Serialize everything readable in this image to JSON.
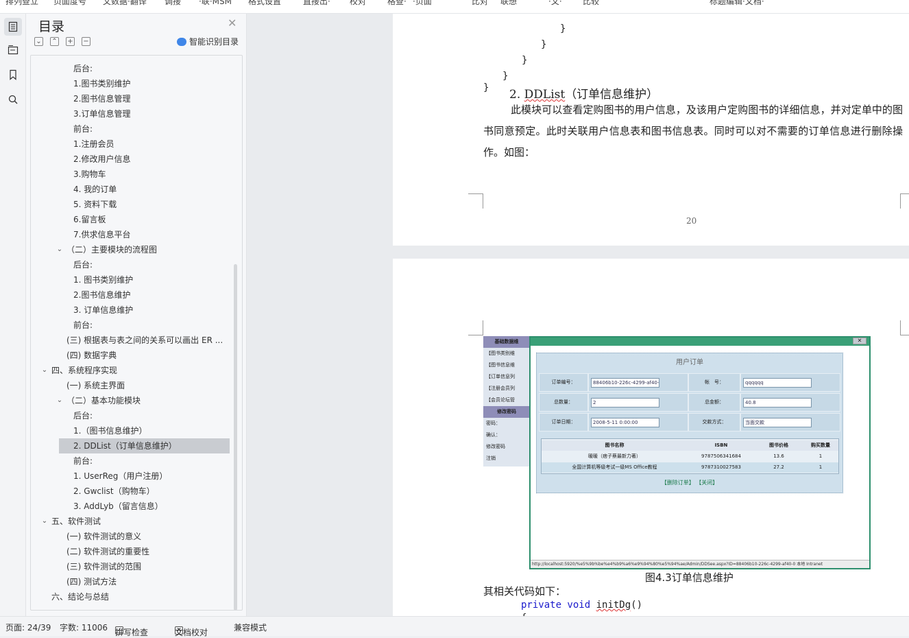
{
  "topbar": {
    "items": [
      "排列查立",
      "页面度号",
      "文数据·翻译",
      "调接",
      "·联·MSM",
      "格式设置",
      "直接出·",
      "校对",
      "格查·",
      "·页面",
      "比对",
      "联想",
      "·文·",
      "比较",
      "标题编辑·文档·"
    ]
  },
  "iconbar": {
    "icons": [
      "toc-icon",
      "outline-icon",
      "bookmark-icon",
      "search-icon"
    ]
  },
  "toc": {
    "title": "目录",
    "smart_label": "智能识别目录",
    "items": [
      {
        "text": "后台:",
        "indent": 3,
        "chev": ""
      },
      {
        "text": "1.图书类别维护",
        "indent": 3,
        "chev": ""
      },
      {
        "text": "2.图书信息管理",
        "indent": 3,
        "chev": ""
      },
      {
        "text": "3.订单信息管理",
        "indent": 3,
        "chev": ""
      },
      {
        "text": "前台:",
        "indent": 3,
        "chev": ""
      },
      {
        "text": "1.注册会员",
        "indent": 3,
        "chev": ""
      },
      {
        "text": "2.修改用户信息",
        "indent": 3,
        "chev": ""
      },
      {
        "text": "3.购物车",
        "indent": 3,
        "chev": ""
      },
      {
        "text": "4. 我的订单",
        "indent": 3,
        "chev": ""
      },
      {
        "text": "5. 资料下载",
        "indent": 3,
        "chev": ""
      },
      {
        "text": "6.留言板",
        "indent": 3,
        "chev": ""
      },
      {
        "text": "7.供求信息平台",
        "indent": 3,
        "chev": ""
      },
      {
        "text": "（二）主要模块的流程图",
        "indent": 2,
        "chev": "v"
      },
      {
        "text": "后台:",
        "indent": 3,
        "chev": ""
      },
      {
        "text": "1. 图书类别维护",
        "indent": 3,
        "chev": ""
      },
      {
        "text": "2.图书信息维护",
        "indent": 3,
        "chev": ""
      },
      {
        "text": "3. 订单信息维护",
        "indent": 3,
        "chev": ""
      },
      {
        "text": "前台:",
        "indent": 3,
        "chev": ""
      },
      {
        "text": "(三) 根据表与表之间的关系可以画出 ER ...",
        "indent": 2,
        "chev": ""
      },
      {
        "text": "(四) 数据字典",
        "indent": 2,
        "chev": ""
      },
      {
        "text": "四、系统程序实现",
        "indent": 1,
        "chev": "v"
      },
      {
        "text": "(一) 系统主界面",
        "indent": 2,
        "chev": ""
      },
      {
        "text": "（二）基本功能模块",
        "indent": 2,
        "chev": "v"
      },
      {
        "text": "后台:",
        "indent": 3,
        "chev": ""
      },
      {
        "text": "1.（图书信息维护）",
        "indent": 3,
        "chev": ""
      },
      {
        "text": "2. DDList（订单信息维护）",
        "indent": 3,
        "chev": "",
        "selected": true
      },
      {
        "text": "前台:",
        "indent": 3,
        "chev": ""
      },
      {
        "text": "1. UserReg（用户注册）",
        "indent": 3,
        "chev": ""
      },
      {
        "text": "2. Gwclist（购物车）",
        "indent": 3,
        "chev": ""
      },
      {
        "text": "3. AddLyb（留言信息）",
        "indent": 3,
        "chev": ""
      },
      {
        "text": "五、软件测试",
        "indent": 1,
        "chev": "v"
      },
      {
        "text": "(一)   软件测试的意义",
        "indent": 2,
        "chev": ""
      },
      {
        "text": "(二) 软件测试的重要性",
        "indent": 2,
        "chev": ""
      },
      {
        "text": "(三) 软件测试的范围",
        "indent": 2,
        "chev": ""
      },
      {
        "text": "(四) 测试方法",
        "indent": 2,
        "chev": ""
      },
      {
        "text": "六、结论与总结",
        "indent": 1,
        "chev": ""
      }
    ]
  },
  "page1": {
    "braces": [
      "}",
      "}",
      "}",
      "}",
      "}"
    ],
    "heading_num": "2.",
    "heading_code": "DDList",
    "heading_text": "（订单信息维护）",
    "paragraph": "此模块可以查看定购图书的用户信息，及该用户定购图书的详细信息，并对定单中的图书同意预定。此时关联用户信息表和图书信息表。同时可以对不需要的订单信息进行删除操作。如图：",
    "page_number": "20"
  },
  "figure": {
    "left_menu": [
      "基础数据维",
      "【图书类别维",
      "【图书信息维",
      "【订单信息列",
      "【注册会员列",
      "【会员论坛管",
      "修改密码",
      "密码：",
      "确认：",
      "修改密码",
      "注销"
    ],
    "window_title": "用户订单",
    "fields": {
      "order_no_label": "订单编号：",
      "order_no": "88406b10-226c-4299-af40-0",
      "account_label": "帐　号：",
      "account": "qqqqqq",
      "qty_label": "总数量：",
      "qty": "2",
      "amount_label": "总金额：",
      "amount": "40.8",
      "date_label": "订单日期：",
      "date": "2008-5-11 0:00:00",
      "pay_label": "交款方式：",
      "pay": "当面交款"
    },
    "table": {
      "headers": [
        "图书名称",
        "ISBN",
        "图书价格",
        "购买数量"
      ],
      "rows": [
        [
          "暖暖（痞子蔡最新力著）",
          "9787506341684",
          "13.6",
          "1"
        ],
        [
          "全国计算机等级考试一级MS Office教程",
          "9787310027583",
          "27.2",
          "1"
        ]
      ]
    },
    "links": "【删除订单】 【关闭】",
    "statusbar": "http://localhost:5920/%e5%9b%be%e4%b9%a6%e9%94%80%e5%94%ae/Admin/DDSee.aspx?ID=88406b10-226c-4299-af40-0    本地 Intranet"
  },
  "page2": {
    "caption": "图4.3订单信息维护",
    "after_text": "其相关代码如下：",
    "code_kw": "private void",
    "code_fn": "initDg",
    "code_rest": "()",
    "code_brace": "{"
  },
  "status": {
    "page": "页面: 24/39",
    "words": "字数: 11006",
    "spell": "拼写检查",
    "proof": "文档校对",
    "compat": "兼容模式"
  }
}
